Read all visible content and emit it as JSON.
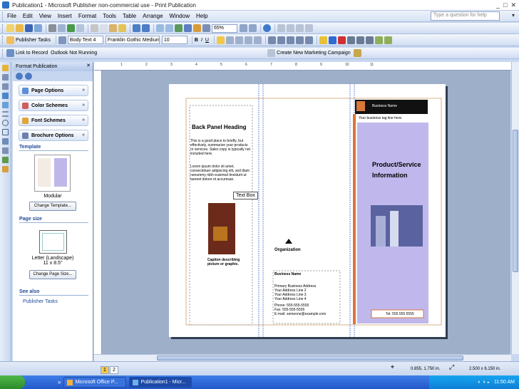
{
  "window": {
    "title": "Publication1 - Microsoft Publisher non-commercial use - Print Publication"
  },
  "menu": {
    "items": [
      "File",
      "Edit",
      "View",
      "Insert",
      "Format",
      "Tools",
      "Table",
      "Arrange",
      "Window",
      "Help"
    ],
    "help_placeholder": "Type a question for help"
  },
  "toolbar": {
    "zoom": "65%",
    "style": "Body Text 4",
    "font": "Franklin Gothic Medium",
    "size": "10",
    "publisher_tasks": "Publisher Tasks",
    "link_to_record": "Link to Record",
    "outlook_status": "Outlook Not Running",
    "new_campaign": "Create New Marketing Campaign"
  },
  "task_pane": {
    "title": "Format Publication",
    "sections": [
      "Page Options",
      "Color Schemes",
      "Font Schemes",
      "Brochure Options"
    ],
    "template_label": "Template",
    "template_name": "Modular",
    "change_template": "Change Template...",
    "page_size_label": "Page size",
    "page_size_name": "Letter (Landscape)",
    "page_size_dims": "11 x 8.5\"",
    "change_page_size": "Change Page Size...",
    "see_also": "See also",
    "publisher_tasks": "Publisher Tasks"
  },
  "ruler": {
    "marks": [
      "1",
      "2",
      "3",
      "4",
      "5",
      "6",
      "7",
      "8",
      "9",
      "10",
      "11"
    ]
  },
  "document": {
    "back_heading": "Back Panel Heading",
    "back_body1": "This is a good place to briefly, but effectively, summarize your products or services. Sales copy is typically not included here.",
    "back_body2": "Lorem ipsum dolor sit amet, consectetuer adipiscing elit, sed diam nonummy nibh euismod tincidunt ut laoreet dolore et accumsan.",
    "tooltip": "Text Box",
    "caption": "Caption describing picture or graphic.",
    "org_name": "Organization",
    "business_name_mid": "Business Name",
    "address_lines": [
      "Primary Business Address",
      "Your Address Line 2",
      "Your Address Line 3",
      "Your Address Line 4",
      "Phone: 555-555-5555",
      "Fax: 555-555-5555",
      "E-mail: someone@example.com"
    ],
    "business_name": "Business Name",
    "tagline": "Your business tag line here.",
    "product_title_1": "Product/Service",
    "product_title_2": "Information",
    "tel": "Tel: 555 555 5555"
  },
  "status": {
    "pages": [
      "1",
      "2"
    ],
    "position": "0.855, 1.750 in.",
    "size": "2.500 x 6.150 in."
  },
  "taskbar": {
    "tasks": [
      "Microsoft Office P...",
      "Publication1 - Micr..."
    ],
    "clock": "11:50 AM"
  },
  "colors": {
    "accent_orange": "#d9763a",
    "panel_lavender": "#c0b8ec",
    "dark_band": "#111111"
  }
}
